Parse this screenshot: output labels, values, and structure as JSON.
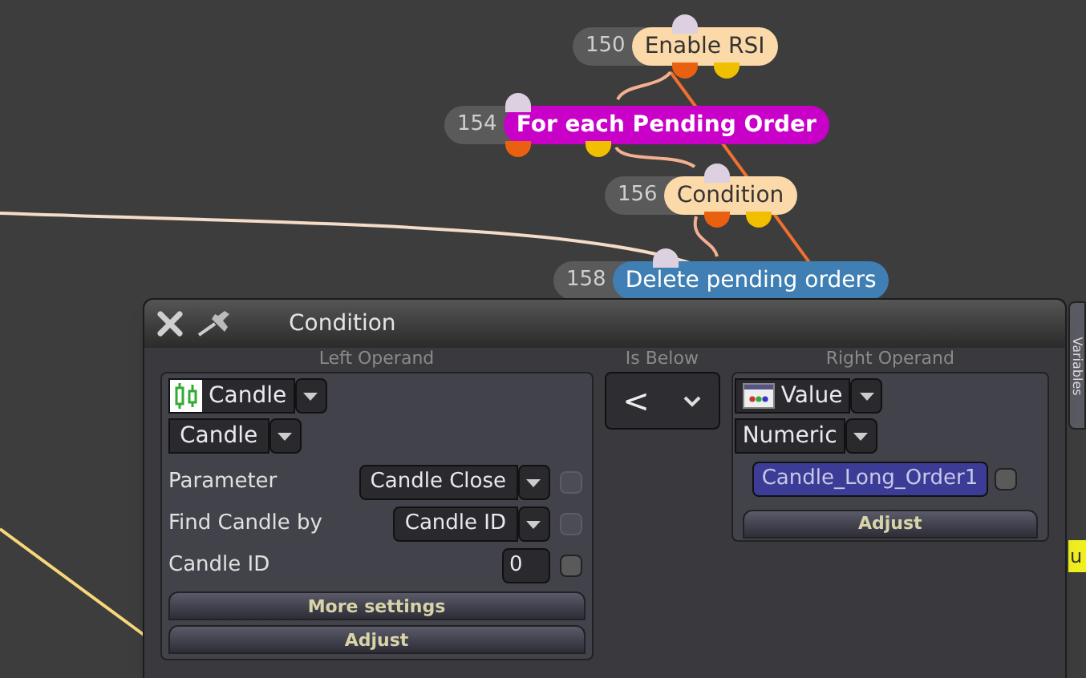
{
  "nodes": [
    {
      "number": "150",
      "label": "Enable RSI",
      "color": "#fcd9a8"
    },
    {
      "number": "154",
      "label": "For each Pending Order",
      "color": "#c800c8"
    },
    {
      "number": "156",
      "label": "Condition",
      "color": "#fcd9a8"
    },
    {
      "number": "158",
      "label": "Delete pending orders",
      "color": "#3f7fb3"
    }
  ],
  "side_tab": {
    "label": "Variables"
  },
  "edge_node": {
    "label": "u",
    "color": "#f0f020"
  },
  "dialog": {
    "title": "Condition",
    "left": {
      "header": "Left Operand",
      "type": "Candle",
      "subtype": "Candle",
      "rows": [
        {
          "kind": "select",
          "label": "Parameter",
          "value": "Candle Close",
          "checked": false,
          "disabled": true
        },
        {
          "kind": "select",
          "label": "Find Candle by",
          "value": "Candle ID",
          "checked": false,
          "disabled": true
        },
        {
          "kind": "input",
          "label": "Candle ID",
          "value": "0",
          "checked": false,
          "disabled": false
        }
      ],
      "buttons": [
        "More settings",
        "Adjust"
      ]
    },
    "operator": {
      "header": "Is Below",
      "value": "<"
    },
    "right": {
      "header": "Right Operand",
      "type": "Value",
      "subtype": "Numeric",
      "value": "Candle_Long_Order1",
      "checked": false,
      "buttons": [
        "Adjust"
      ]
    }
  }
}
